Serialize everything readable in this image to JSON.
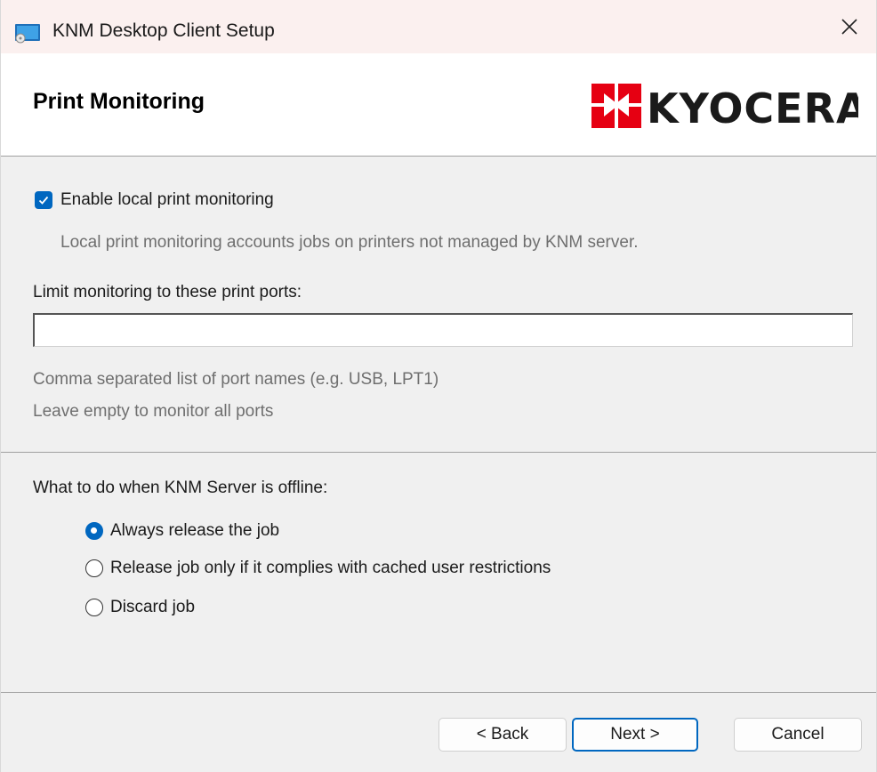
{
  "window": {
    "title": "KNM Desktop Client Setup"
  },
  "header": {
    "title": "Print Monitoring",
    "logo_text": "KYOCERA"
  },
  "local_monitoring": {
    "enable_label": "Enable local print monitoring",
    "enabled": true,
    "description": "Local print monitoring accounts jobs on printers not managed by KNM server."
  },
  "ports": {
    "label": "Limit monitoring to these print ports:",
    "value": "",
    "hint_line1": "Comma separated list of port names (e.g. USB, LPT1)",
    "hint_line2": "Leave empty to monitor all ports"
  },
  "offline": {
    "label": "What to do when KNM Server is offline:",
    "options": [
      {
        "label": "Always release the job",
        "selected": true
      },
      {
        "label": "Release job only if it complies with cached user restrictions",
        "selected": false
      },
      {
        "label": "Discard job",
        "selected": false
      }
    ]
  },
  "buttons": {
    "back": "< Back",
    "next": "Next >",
    "cancel": "Cancel"
  },
  "colors": {
    "accent": "#0067c0",
    "logo_red": "#e60012",
    "titlebar": "#fbf0ef",
    "panel": "#f0f0f0"
  }
}
